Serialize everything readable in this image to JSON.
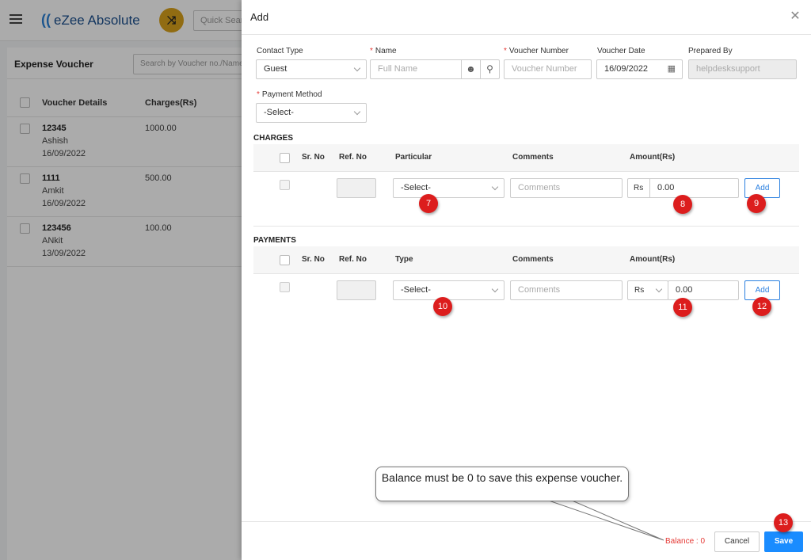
{
  "app": {
    "logo_text": "eZee Absolute",
    "quick_search_placeholder": "Quick Search",
    "list_title": "Expense Voucher",
    "list_search_placeholder": "Search by Voucher no./Name",
    "columns": [
      "Voucher Details",
      "Charges(Rs)"
    ],
    "vouchers": [
      {
        "number": "12345",
        "name": "Ashish",
        "date": "16/09/2022",
        "charges": "1000.00"
      },
      {
        "number": "1111",
        "name": "Amkit",
        "date": "16/09/2022",
        "charges": "500.00"
      },
      {
        "number": "123456",
        "name": "ANkit",
        "date": "13/09/2022",
        "charges": "100.00"
      }
    ]
  },
  "drawer": {
    "title": "Add",
    "fields": {
      "contact_type_label": "Contact Type",
      "contact_type_value": "Guest",
      "name_label": "Name",
      "name_placeholder": "Full Name",
      "voucher_number_label": "Voucher Number",
      "voucher_number_placeholder": "Voucher Number",
      "voucher_date_label": "Voucher Date",
      "voucher_date_value": "16/09/2022",
      "prepared_by_label": "Prepared By",
      "prepared_by_value": "helpdesksupport",
      "payment_method_label": "Payment Method",
      "payment_method_value": "-Select-"
    },
    "charges": {
      "title": "CHARGES",
      "headers": [
        "Sr. No",
        "Ref. No",
        "Particular",
        "Comments",
        "Amount(Rs)"
      ],
      "particular_value": "-Select-",
      "comments_placeholder": "Comments",
      "currency": "Rs",
      "amount": "0.00",
      "add_label": "Add"
    },
    "payments": {
      "title": "PAYMENTS",
      "headers": [
        "Sr. No",
        "Ref. No",
        "Type",
        "Comments",
        "Amount(Rs)"
      ],
      "type_value": "-Select-",
      "comments_placeholder": "Comments",
      "currency": "Rs",
      "amount": "0.00",
      "add_label": "Add"
    },
    "footer": {
      "balance": "Balance : 0",
      "cancel_label": "Cancel",
      "save_label": "Save"
    }
  },
  "annotations": {
    "callout": "Balance must be 0 to save this expense voucher.",
    "badges": [
      "7",
      "8",
      "9",
      "10",
      "11",
      "12",
      "13"
    ]
  },
  "colors": {
    "primary": "#1a8cff",
    "badge": "#dc1d1d",
    "required": "#e53935",
    "shuffle": "#d9a21c"
  }
}
